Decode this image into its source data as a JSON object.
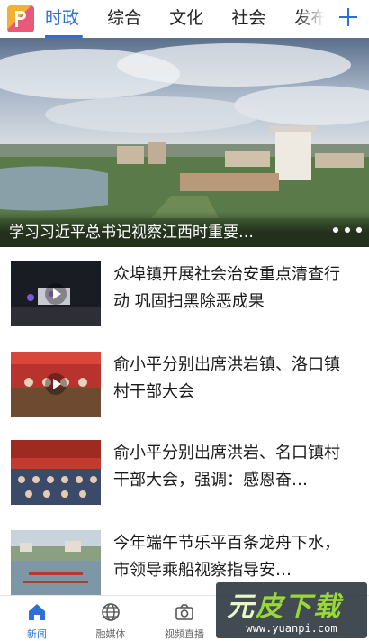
{
  "header": {
    "logo": "app-logo",
    "tabs": [
      {
        "label": "时政",
        "active": true
      },
      {
        "label": "综合"
      },
      {
        "label": "文化"
      },
      {
        "label": "社会"
      },
      {
        "label": "发布"
      }
    ],
    "add_icon": "plus-icon"
  },
  "banner": {
    "title": "学习习近平总书记视察江西时重要…",
    "slide_count": 3,
    "current_slide": 1
  },
  "news": [
    {
      "headline": "众埠镇开展社会治安重点清查行动 巩固扫黑除恶成果",
      "video": true
    },
    {
      "headline": "俞小平分别出席洪岩镇、洛口镇村干部大会",
      "video": true
    },
    {
      "headline": "俞小平分别出席洪岩、名口镇村干部大会，强调：感恩奋…",
      "video": false
    },
    {
      "headline": "今年端午节乐平百条龙舟下水，市领导乘船视察指导安…",
      "video": false
    }
  ],
  "bottom_nav": [
    {
      "label": "新闻",
      "icon": "home-icon",
      "active": true
    },
    {
      "label": "融媒体",
      "icon": "globe-icon"
    },
    {
      "label": "视频直播",
      "icon": "camera-icon"
    }
  ],
  "watermark": {
    "main_a": "元",
    "main_b": "皮下载",
    "url": "www.yuanpi.com"
  },
  "colors": {
    "accent": "#2c6fd8",
    "text": "#1a1a1a"
  }
}
